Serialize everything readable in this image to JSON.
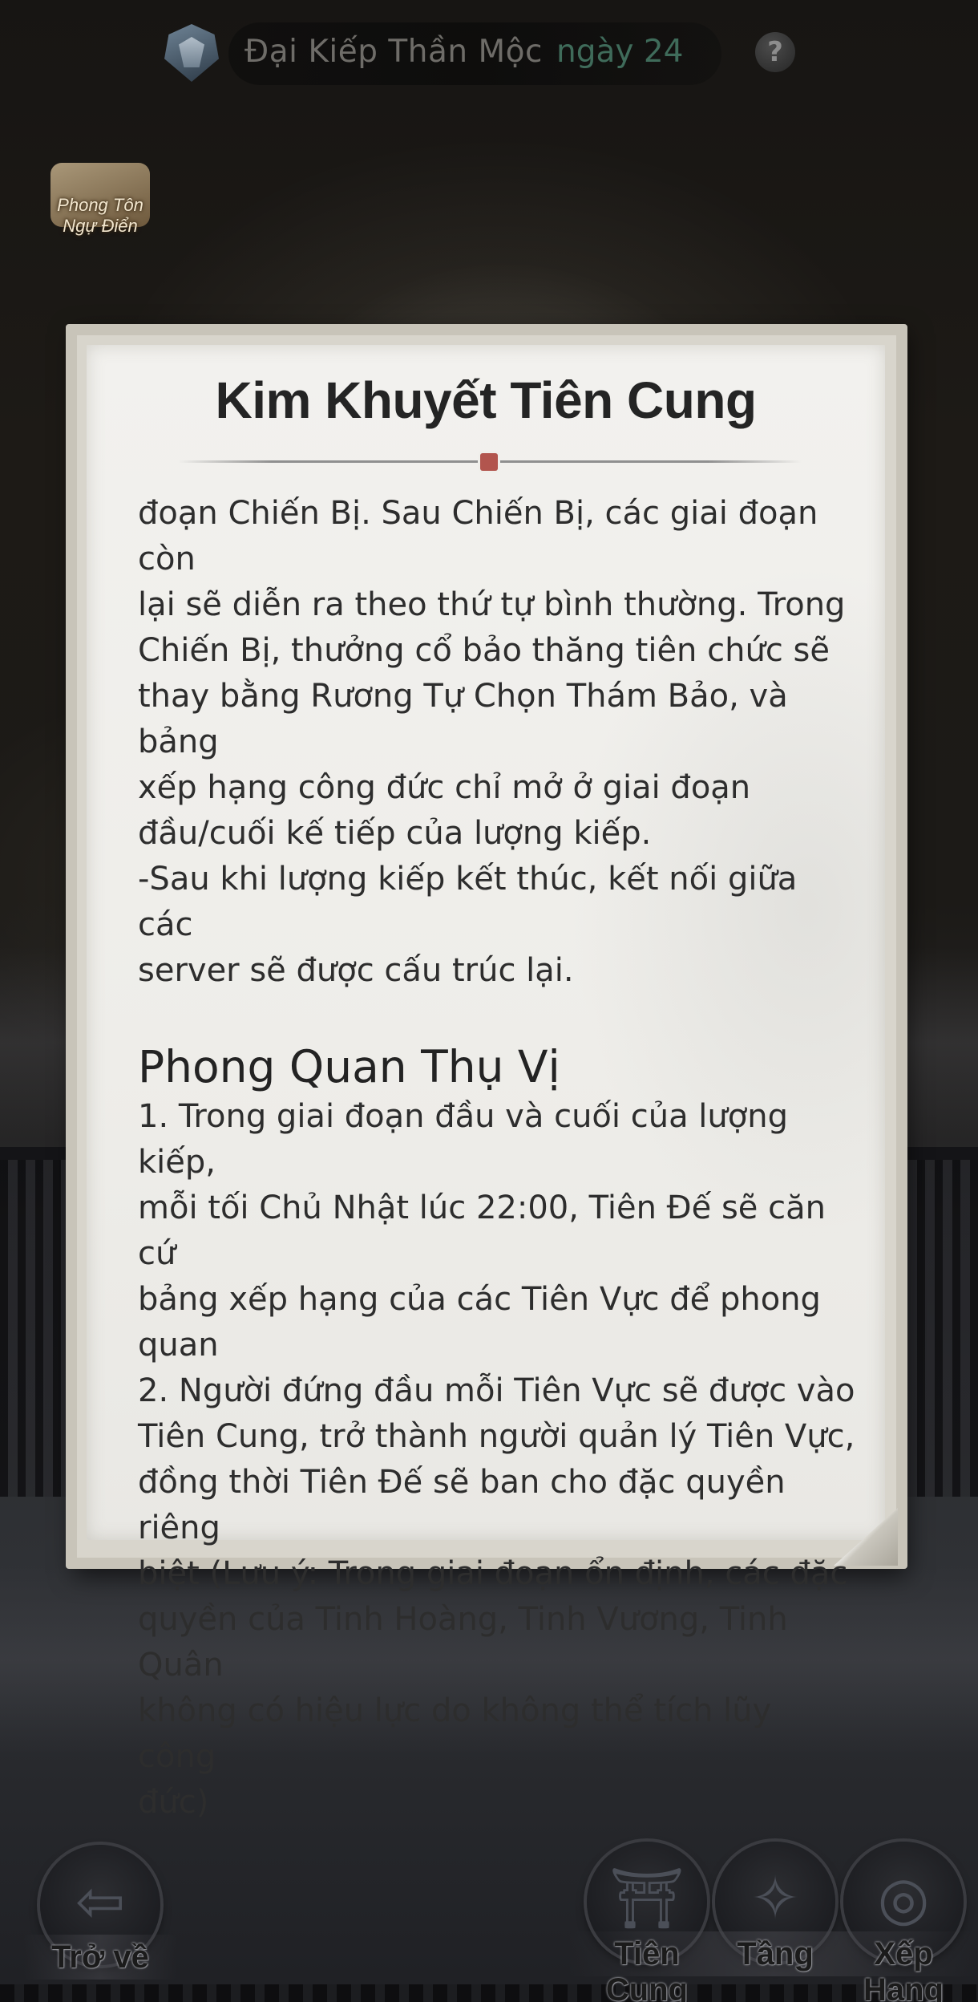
{
  "header": {
    "event_name": "Đại Kiếp Thần Mộc",
    "day_label": "ngày 24",
    "help_glyph": "?"
  },
  "side_badge": {
    "line1": "Phong Tôn",
    "line2": "Ngự Điển"
  },
  "panel": {
    "title": "Kim Khuyết Tiên Cung",
    "intro_lines": [
      "đoạn Chiến Bị. Sau Chiến Bị, các giai đoạn còn",
      "lại sẽ diễn ra theo thứ tự bình thường. Trong",
      "Chiến Bị, thưởng cổ bảo thăng tiên chức sẽ",
      "thay bằng Rương Tự Chọn Thám Bảo, và bảng",
      "xếp hạng công đức chỉ mở ở giai đoạn",
      "đầu/cuối kế tiếp của lượng kiếp.",
      "-Sau khi lượng kiếp kết thúc, kết nối giữa các",
      "server sẽ được cấu trúc lại."
    ],
    "section_heading": "Phong Quan Thụ Vị",
    "section_lines": [
      "1. Trong giai đoạn đầu và cuối của lượng kiếp,",
      "mỗi tối Chủ Nhật lúc 22:00, Tiên Đế sẽ căn cứ",
      "bảng xếp hạng của các Tiên Vực để phong",
      "quan",
      "2. Người đứng đầu mỗi Tiên Vực sẽ được vào",
      "Tiên Cung, trở thành người quản lý Tiên Vực,",
      "đồng thời Tiên Đế sẽ ban cho đặc quyền riêng",
      "biệt (Lưu ý: Trong giai đoạn ổn định, các đặc",
      "quyền của Tinh Hoàng, Tinh Vương, Tinh Quân",
      "không có hiệu lực do không thể tích lũy công",
      "đức)"
    ]
  },
  "bottom_nav": {
    "back_label": "Trở về",
    "tien_cung_label": "Tiên Cung",
    "tang_label": "Tầng",
    "xep_hang_label": "Xếp Hạng"
  },
  "icons": {
    "back": "arrow-left-icon",
    "tien_cung": "gate-icon",
    "tang": "constellation-icon",
    "xep_hang": "banner-icon",
    "help": "question-icon",
    "emblem": "shield-emblem-icon"
  }
}
